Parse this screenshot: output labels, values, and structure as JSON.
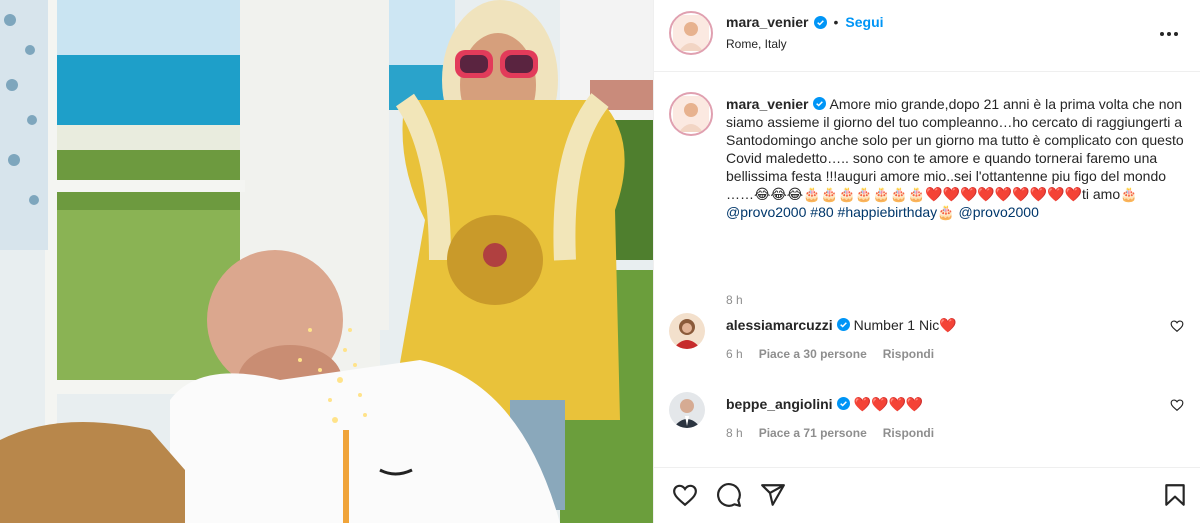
{
  "post": {
    "username": "mara_venier",
    "follow_label": "Segui",
    "separator": "•",
    "location": "Rome, Italy",
    "caption_username": "mara_venier",
    "caption_text": "Amore mio grande,dopo 21 anni è la prima volta che non siamo assieme il giorno del tuo compleanno…ho cercato di raggiungerti a Santodomingo anche solo per un giorno ma tutto è complicato con questo Covid maledetto….. sono con te amore e quando tornerai faremo una bellissima festa !!!auguri amore mio..sei l'ottantenne piu figo del mondo ……😂😂😂🎂🎂🎂🎂🎂🎂🎂❤️❤️❤️❤️❤️❤️❤️❤️❤️ti amo🎂",
    "caption_mention_1": "@provo2000",
    "caption_tag_80": "#80",
    "caption_tag_happie": "#happiebirthday🎂",
    "caption_mention_2": "@provo2000",
    "caption_time": "8 h"
  },
  "comments": [
    {
      "username": "alessiamarcuzzi",
      "text": "Number 1 Nic❤️",
      "time": "6 h",
      "likes": "Piace a 30 persone",
      "reply": "Rispondi"
    },
    {
      "username": "beppe_angiolini",
      "text": "❤️❤️❤️❤️",
      "time": "8 h",
      "likes": "Piace a 71 persone",
      "reply": "Rispondi"
    }
  ],
  "icons": {
    "more": "more-options-icon",
    "like": "heart-icon",
    "comment": "comment-icon",
    "share": "share-icon",
    "save": "bookmark-icon",
    "verified": "verified-badge-icon"
  },
  "colors": {
    "accent": "#0095f6",
    "text": "#262626",
    "muted": "#8e8e8e",
    "mention": "#00376b",
    "verified": "#0095f6",
    "border": "#efefef"
  }
}
